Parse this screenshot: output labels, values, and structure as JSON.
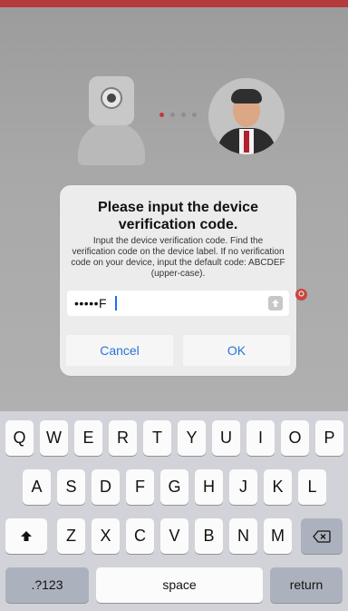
{
  "dialog": {
    "title": "Please input the device verification code.",
    "message": "Input the device verification code. Find the verification code on the device label. If no verification code on your device, input the default code: ABCDEF (upper-case).",
    "input_value": "•••••F",
    "cancel_label": "Cancel",
    "ok_label": "OK"
  },
  "keyboard": {
    "row1": [
      "Q",
      "W",
      "E",
      "R",
      "T",
      "Y",
      "U",
      "I",
      "O",
      "P"
    ],
    "row2": [
      "A",
      "S",
      "D",
      "F",
      "G",
      "H",
      "J",
      "K",
      "L"
    ],
    "row3": [
      "Z",
      "X",
      "C",
      "V",
      "B",
      "N",
      "M"
    ],
    "bottom": {
      "numbers": ".?123",
      "space": "space",
      "return": "return"
    }
  },
  "colors": {
    "accent": "#2b73d8",
    "badge": "#c7463f",
    "topbar": "#b53a3a"
  },
  "icons": {
    "camera": "camera-icon",
    "avatar": "user-avatar-icon",
    "shift": "shift-icon",
    "backspace": "backspace-icon",
    "keyboard-toggle": "keyboard-toggle-icon"
  }
}
